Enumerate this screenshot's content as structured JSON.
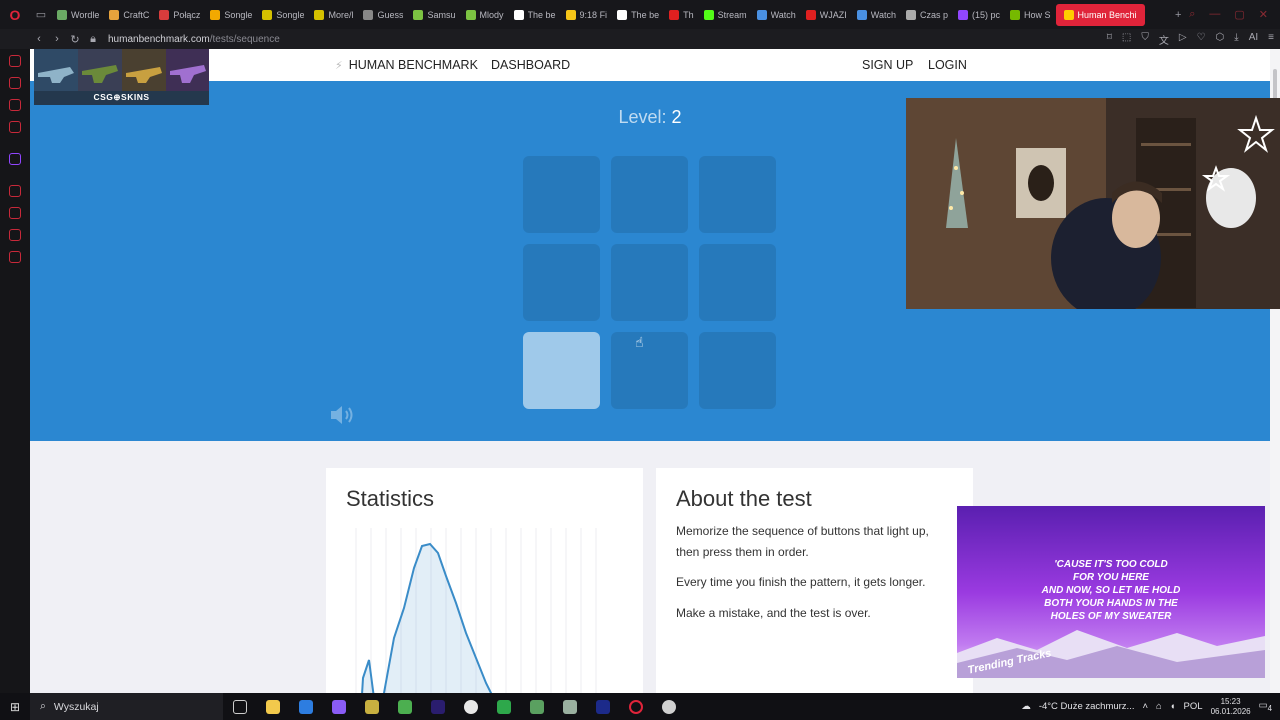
{
  "browser": {
    "tabs": [
      {
        "label": "Wordle",
        "color": "#6aaa64"
      },
      {
        "label": "CraftC",
        "color": "#e6a23c"
      },
      {
        "label": "Połącz",
        "color": "#d83c3c"
      },
      {
        "label": "Songle",
        "color": "#f2a900"
      },
      {
        "label": "Songle",
        "color": "#d4c000"
      },
      {
        "label": "More/l",
        "color": "#d4c000"
      },
      {
        "label": "Guess",
        "color": "#888888"
      },
      {
        "label": "Samsu",
        "color": "#7cc342"
      },
      {
        "label": "Mlody",
        "color": "#7cc342"
      },
      {
        "label": "The be",
        "color": "#ffffff"
      },
      {
        "label": "9:18 Fi",
        "color": "#f5c518"
      },
      {
        "label": "The be",
        "color": "#ffffff"
      },
      {
        "label": "Th",
        "color": "#e02020"
      },
      {
        "label": "Stream",
        "color": "#53fc18"
      },
      {
        "label": "Watch",
        "color": "#4a90e2"
      },
      {
        "label": "WJAZI",
        "color": "#e02020"
      },
      {
        "label": "Watch",
        "color": "#4a90e2"
      },
      {
        "label": "Czas p",
        "color": "#aaaaaa"
      },
      {
        "label": "(15) pc",
        "color": "#9146ff"
      },
      {
        "label": "How S",
        "color": "#76b900"
      },
      {
        "label": "Human Benchi",
        "color": "#ffcc00",
        "active": true
      }
    ],
    "new_tab": "+",
    "url_host": "humanbenchmark.com",
    "url_path": "/tests/sequence"
  },
  "site": {
    "brand": "HUMAN BENCHMARK",
    "dashboard": "DASHBOARD",
    "sign_up": "SIGN UP",
    "login": "LOGIN"
  },
  "game": {
    "level_label": "Level:",
    "level_value": "2",
    "lit_index": 6,
    "squares": 9
  },
  "statistics": {
    "title": "Statistics",
    "curve_color": "#3a8cc8"
  },
  "about": {
    "title": "About the test",
    "paragraphs": [
      "Memorize the sequence of buttons that light up, then press them in order.",
      "Every time you finish the pattern, it gets longer.",
      "Make a mistake, and the test is over."
    ]
  },
  "overlays": {
    "cs_ad_label": "CSG⊕SKINS",
    "lyrics": [
      "'CAUSE IT'S TOO COLD",
      "FOR YOU HERE",
      "AND NOW, SO LET ME HOLD",
      "BOTH YOUR HANDS IN THE",
      "HOLES OF MY SWEATER"
    ],
    "music_logo": "Trending Tracks"
  },
  "taskbar": {
    "search_placeholder": "Wyszukaj",
    "weather": "-4°C  Duże zachmurz...",
    "lang": "POL",
    "time": "15:23",
    "date": "06.01.2026",
    "notifications": "4"
  }
}
